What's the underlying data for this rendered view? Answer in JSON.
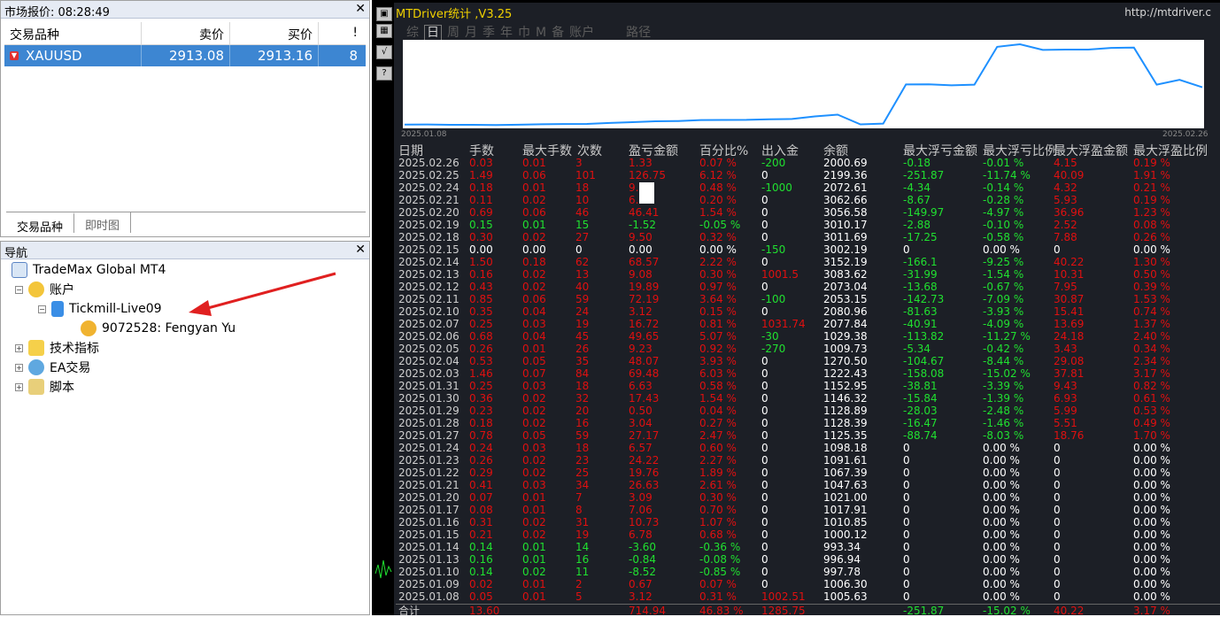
{
  "market_watch": {
    "title": "市场报价: 08:28:49",
    "columns": [
      "交易品种",
      "卖价",
      "买价",
      "!"
    ],
    "rows": [
      {
        "symbol": "XAUUSD",
        "bid": "2913.08",
        "ask": "2913.16",
        "spread": "8"
      }
    ],
    "tabs": [
      "交易品种",
      "即时图"
    ]
  },
  "navigator": {
    "title": "导航",
    "items": [
      "TradeMax Global MT4",
      "账户",
      "Tickmill-Live09",
      "9072528: Fengyan Yu",
      "技术指标",
      "EA交易",
      "脚本"
    ]
  },
  "chart": {
    "title": "MTDriver统计 ,V3.25",
    "url": "http://mtdriver.c",
    "periods": [
      "综",
      "日",
      "周",
      "月",
      "季",
      "年",
      "巾",
      "M",
      "备",
      "账户",
      "路径"
    ],
    "active_period": "日",
    "axis_start": "2025.01.08",
    "axis_end": "2025.02.26",
    "balance_curve": [
      2000.69,
      1005.63,
      1006.3,
      997.78,
      996.94,
      993.34,
      1000.12,
      1010.85,
      1017.91,
      1021.0,
      1047.63,
      1067.39,
      1091.61,
      1098.18,
      1125.35,
      1128.39,
      1128.89,
      1146.32,
      1152.95,
      1222.43,
      1270.5,
      1009.73,
      1029.38,
      2077.84,
      2080.96,
      2053.15,
      2073.04,
      3083.62,
      3152.19,
      3002.19,
      3011.69,
      3010.17,
      3056.58,
      3062.66,
      2072.61,
      2199.36,
      2000.69
    ],
    "line_color": "#1e90ff"
  },
  "stats": {
    "headers": [
      "日期",
      "手数",
      "最大手数",
      "次数",
      "盈亏金额",
      "百分比%",
      "出入金",
      "余额",
      "最大浮亏金额",
      "最大浮亏比例",
      "最大浮盈金额",
      "最大浮盈比例"
    ],
    "rows": [
      [
        "2025.02.26",
        "0.03",
        "0.01",
        "3",
        "1.33",
        "0.07 %",
        "-200",
        "2000.69",
        "-0.18",
        "-0.01 %",
        "4.15",
        "0.19 %",
        "r"
      ],
      [
        "2025.02.25",
        "1.49",
        "0.06",
        "101",
        "126.75",
        "6.12 %",
        "0",
        "2199.36",
        "-251.87",
        "-11.74 %",
        "40.09",
        "1.91 %",
        "r"
      ],
      [
        "2025.02.24",
        "0.18",
        "0.01",
        "18",
        "9.",
        "0.48 %",
        "-1000",
        "2072.61",
        "-4.34",
        "-0.14 %",
        "4.32",
        "0.21 %",
        "r"
      ],
      [
        "2025.02.21",
        "0.11",
        "0.02",
        "10",
        "6.",
        "0.20 %",
        "0",
        "3062.66",
        "-8.67",
        "-0.28 %",
        "5.93",
        "0.19 %",
        "r"
      ],
      [
        "2025.02.20",
        "0.69",
        "0.06",
        "46",
        "46.41",
        "1.54 %",
        "0",
        "3056.58",
        "-149.97",
        "-4.97 %",
        "36.96",
        "1.23 %",
        "r"
      ],
      [
        "2025.02.19",
        "0.15",
        "0.01",
        "15",
        "-1.52",
        "-0.05 %",
        "0",
        "3010.17",
        "-2.88",
        "-0.10 %",
        "2.52",
        "0.08 %",
        "g"
      ],
      [
        "2025.02.18",
        "0.30",
        "0.02",
        "27",
        "9.50",
        "0.32 %",
        "0",
        "3011.69",
        "-17.25",
        "-0.58 %",
        "7.88",
        "0.26 %",
        "r"
      ],
      [
        "2025.02.15",
        "0.00",
        "0.00",
        "0",
        "0.00",
        "0.00 %",
        "-150",
        "3002.19",
        "0",
        "0.00 %",
        "0",
        "0.00 %",
        "w"
      ],
      [
        "2025.02.14",
        "1.50",
        "0.18",
        "62",
        "68.57",
        "2.22 %",
        "0",
        "3152.19",
        "-166.1",
        "-9.25 %",
        "40.22",
        "1.30 %",
        "r"
      ],
      [
        "2025.02.13",
        "0.16",
        "0.02",
        "13",
        "9.08",
        "0.30 %",
        "1001.5",
        "3083.62",
        "-31.99",
        "-1.54 %",
        "10.31",
        "0.50 %",
        "r"
      ],
      [
        "2025.02.12",
        "0.43",
        "0.02",
        "40",
        "19.89",
        "0.97 %",
        "0",
        "2073.04",
        "-13.68",
        "-0.67 %",
        "7.95",
        "0.39 %",
        "r"
      ],
      [
        "2025.02.11",
        "0.85",
        "0.06",
        "59",
        "72.19",
        "3.64 %",
        "-100",
        "2053.15",
        "-142.73",
        "-7.09 %",
        "30.87",
        "1.53 %",
        "r"
      ],
      [
        "2025.02.10",
        "0.35",
        "0.04",
        "24",
        "3.12",
        "0.15 %",
        "0",
        "2080.96",
        "-81.63",
        "-3.93 %",
        "15.41",
        "0.74 %",
        "r"
      ],
      [
        "2025.02.07",
        "0.25",
        "0.03",
        "19",
        "16.72",
        "0.81 %",
        "1031.74",
        "2077.84",
        "-40.91",
        "-4.09 %",
        "13.69",
        "1.37 %",
        "r"
      ],
      [
        "2025.02.06",
        "0.68",
        "0.04",
        "45",
        "49.65",
        "5.07 %",
        "-30",
        "1029.38",
        "-113.82",
        "-11.27 %",
        "24.18",
        "2.40 %",
        "r"
      ],
      [
        "2025.02.05",
        "0.26",
        "0.01",
        "26",
        "9.23",
        "0.92 %",
        "-270",
        "1009.73",
        "-5.34",
        "-0.42 %",
        "3.43",
        "0.34 %",
        "r"
      ],
      [
        "2025.02.04",
        "0.53",
        "0.05",
        "35",
        "48.07",
        "3.93 %",
        "0",
        "1270.50",
        "-104.67",
        "-8.44 %",
        "29.08",
        "2.34 %",
        "r"
      ],
      [
        "2025.02.03",
        "1.46",
        "0.07",
        "84",
        "69.48",
        "6.03 %",
        "0",
        "1222.43",
        "-158.08",
        "-15.02 %",
        "37.81",
        "3.17 %",
        "r"
      ],
      [
        "2025.01.31",
        "0.25",
        "0.03",
        "18",
        "6.63",
        "0.58 %",
        "0",
        "1152.95",
        "-38.81",
        "-3.39 %",
        "9.43",
        "0.82 %",
        "r"
      ],
      [
        "2025.01.30",
        "0.36",
        "0.02",
        "32",
        "17.43",
        "1.54 %",
        "0",
        "1146.32",
        "-15.84",
        "-1.39 %",
        "6.93",
        "0.61 %",
        "r"
      ],
      [
        "2025.01.29",
        "0.23",
        "0.02",
        "20",
        "0.50",
        "0.04 %",
        "0",
        "1128.89",
        "-28.03",
        "-2.48 %",
        "5.99",
        "0.53 %",
        "r"
      ],
      [
        "2025.01.28",
        "0.18",
        "0.02",
        "16",
        "3.04",
        "0.27 %",
        "0",
        "1128.39",
        "-16.47",
        "-1.46 %",
        "5.51",
        "0.49 %",
        "r"
      ],
      [
        "2025.01.27",
        "0.78",
        "0.05",
        "59",
        "27.17",
        "2.47 %",
        "0",
        "1125.35",
        "-88.74",
        "-8.03 %",
        "18.76",
        "1.70 %",
        "r"
      ],
      [
        "2025.01.24",
        "0.24",
        "0.03",
        "18",
        "6.57",
        "0.60 %",
        "0",
        "1098.18",
        "0",
        "0.00 %",
        "0",
        "0.00 %",
        "r"
      ],
      [
        "2025.01.23",
        "0.26",
        "0.02",
        "23",
        "24.22",
        "2.27 %",
        "0",
        "1091.61",
        "0",
        "0.00 %",
        "0",
        "0.00 %",
        "r"
      ],
      [
        "2025.01.22",
        "0.29",
        "0.02",
        "25",
        "19.76",
        "1.89 %",
        "0",
        "1067.39",
        "0",
        "0.00 %",
        "0",
        "0.00 %",
        "r"
      ],
      [
        "2025.01.21",
        "0.41",
        "0.03",
        "34",
        "26.63",
        "2.61 %",
        "0",
        "1047.63",
        "0",
        "0.00 %",
        "0",
        "0.00 %",
        "r"
      ],
      [
        "2025.01.20",
        "0.07",
        "0.01",
        "7",
        "3.09",
        "0.30 %",
        "0",
        "1021.00",
        "0",
        "0.00 %",
        "0",
        "0.00 %",
        "r"
      ],
      [
        "2025.01.17",
        "0.08",
        "0.01",
        "8",
        "7.06",
        "0.70 %",
        "0",
        "1017.91",
        "0",
        "0.00 %",
        "0",
        "0.00 %",
        "r"
      ],
      [
        "2025.01.16",
        "0.31",
        "0.02",
        "31",
        "10.73",
        "1.07 %",
        "0",
        "1010.85",
        "0",
        "0.00 %",
        "0",
        "0.00 %",
        "r"
      ],
      [
        "2025.01.15",
        "0.21",
        "0.02",
        "19",
        "6.78",
        "0.68 %",
        "0",
        "1000.12",
        "0",
        "0.00 %",
        "0",
        "0.00 %",
        "r"
      ],
      [
        "2025.01.14",
        "0.14",
        "0.01",
        "14",
        "-3.60",
        "-0.36 %",
        "0",
        "993.34",
        "0",
        "0.00 %",
        "0",
        "0.00 %",
        "g"
      ],
      [
        "2025.01.13",
        "0.16",
        "0.01",
        "16",
        "-0.84",
        "-0.08 %",
        "0",
        "996.94",
        "0",
        "0.00 %",
        "0",
        "0.00 %",
        "g"
      ],
      [
        "2025.01.10",
        "0.14",
        "0.02",
        "11",
        "-8.52",
        "-0.85 %",
        "0",
        "997.78",
        "0",
        "0.00 %",
        "0",
        "0.00 %",
        "g"
      ],
      [
        "2025.01.09",
        "0.02",
        "0.01",
        "2",
        "0.67",
        "0.07 %",
        "0",
        "1006.30",
        "0",
        "0.00 %",
        "0",
        "0.00 %",
        "r"
      ],
      [
        "2025.01.08",
        "0.05",
        "0.01",
        "5",
        "3.12",
        "0.31 %",
        "1002.51",
        "1005.63",
        "0",
        "0.00 %",
        "0",
        "0.00 %",
        "r"
      ]
    ],
    "total": [
      "合计",
      "13.60",
      "",
      "",
      "714.94",
      "46.83 %",
      "1285.75",
      "",
      "-251.87",
      "-15.02 %",
      "40.22",
      "3.17 %"
    ]
  },
  "colors": {
    "up": "#e01010",
    "down": "#20e030",
    "selected": "#3d86d2"
  }
}
